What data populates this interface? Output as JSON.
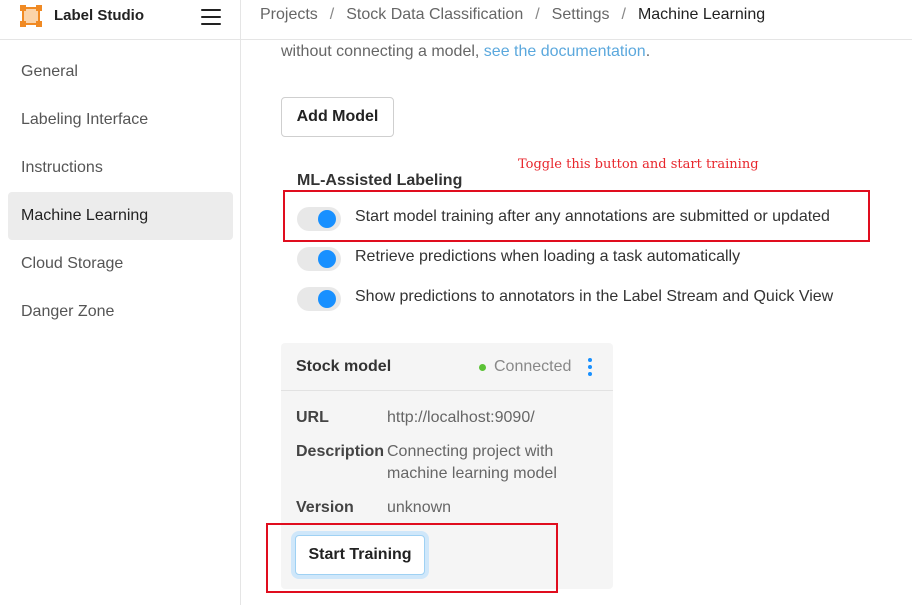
{
  "app": {
    "name": "Label Studio"
  },
  "breadcrumb": [
    "Projects",
    "Stock Data Classification",
    "Settings",
    "Machine Learning"
  ],
  "sidebar": {
    "items": [
      {
        "label": "General",
        "active": false
      },
      {
        "label": "Labeling Interface",
        "active": false
      },
      {
        "label": "Instructions",
        "active": false
      },
      {
        "label": "Machine Learning",
        "active": true
      },
      {
        "label": "Cloud Storage",
        "active": false
      },
      {
        "label": "Danger Zone",
        "active": false
      }
    ]
  },
  "main": {
    "intro_text": "without connecting a model, ",
    "intro_link": "see the documentation",
    "intro_end": ".",
    "add_model_label": "Add Model",
    "annotation": "Toggle this button and start training",
    "section_title": "ML-Assisted Labeling",
    "toggles": [
      {
        "label": "Start model training after any annotations are submitted or updated",
        "on": true
      },
      {
        "label": "Retrieve predictions when loading a task automatically",
        "on": true
      },
      {
        "label": "Show predictions to annotators in the Label Stream and Quick View",
        "on": true
      }
    ]
  },
  "model_card": {
    "title": "Stock model",
    "status": "Connected",
    "url_label": "URL",
    "url_value": "http://localhost:9090/",
    "description_label": "Description",
    "description_line1": "Connecting project with",
    "description_line2": "machine learning model",
    "version_label": "Version",
    "version_value": "unknown",
    "start_training_label": "Start Training"
  },
  "colors": {
    "accent": "#1890ff",
    "link": "#5ba8dd",
    "annotation": "#e00d1e",
    "status_connected": "#5bc236",
    "logo": "#f08a24"
  }
}
